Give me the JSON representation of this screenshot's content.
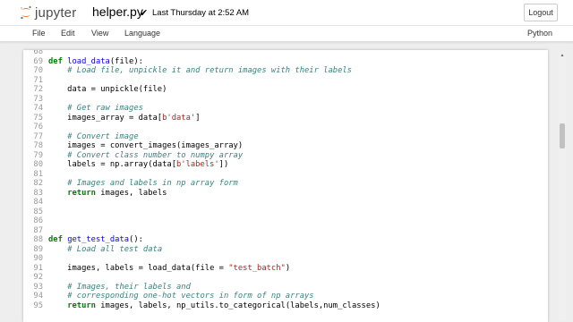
{
  "header": {
    "logo_text": "jupyter",
    "filename": "helper.py",
    "save_check": "✔",
    "save_status": "Last Thursday at 2:52 AM",
    "logout_label": "Logout"
  },
  "menu": {
    "items": [
      "File",
      "Edit",
      "View",
      "Language"
    ],
    "language_indicator": "Python"
  },
  "colors": {
    "keyword": "#008000",
    "function_name": "#0000ff",
    "comment": "#408080",
    "string": "#ba2121",
    "line_number": "#999999",
    "logo_orange": "#f37726"
  },
  "code_lines": [
    {
      "n": "68",
      "tokens": []
    },
    {
      "n": "69",
      "tokens": [
        {
          "t": "kw",
          "v": "def "
        },
        {
          "t": "def",
          "v": "load_data"
        },
        {
          "t": "",
          "v": "(file):"
        }
      ]
    },
    {
      "n": "70",
      "tokens": [
        {
          "t": "",
          "v": "    "
        },
        {
          "t": "cm",
          "v": "# Load file, unpickle it and return images with their labels"
        }
      ]
    },
    {
      "n": "71",
      "tokens": []
    },
    {
      "n": "72",
      "tokens": [
        {
          "t": "",
          "v": "    data = unpickle(file)"
        }
      ]
    },
    {
      "n": "73",
      "tokens": []
    },
    {
      "n": "74",
      "tokens": [
        {
          "t": "",
          "v": "    "
        },
        {
          "t": "cm",
          "v": "# Get raw images"
        }
      ]
    },
    {
      "n": "75",
      "tokens": [
        {
          "t": "",
          "v": "    images_array = data["
        },
        {
          "t": "st",
          "v": "b'data'"
        },
        {
          "t": "",
          "v": "]"
        }
      ]
    },
    {
      "n": "76",
      "tokens": []
    },
    {
      "n": "77",
      "tokens": [
        {
          "t": "",
          "v": "    "
        },
        {
          "t": "cm",
          "v": "# Convert image"
        }
      ]
    },
    {
      "n": "78",
      "tokens": [
        {
          "t": "",
          "v": "    images = convert_images(images_array)"
        }
      ]
    },
    {
      "n": "79",
      "tokens": [
        {
          "t": "",
          "v": "    "
        },
        {
          "t": "cm",
          "v": "# Convert class number to numpy array"
        }
      ]
    },
    {
      "n": "80",
      "tokens": [
        {
          "t": "",
          "v": "    labels = np.array(data["
        },
        {
          "t": "st",
          "v": "b'labels'"
        },
        {
          "t": "",
          "v": "])"
        }
      ]
    },
    {
      "n": "81",
      "tokens": []
    },
    {
      "n": "82",
      "tokens": [
        {
          "t": "",
          "v": "    "
        },
        {
          "t": "cm",
          "v": "# Images and labels in np array form"
        }
      ]
    },
    {
      "n": "83",
      "tokens": [
        {
          "t": "",
          "v": "    "
        },
        {
          "t": "kw",
          "v": "return"
        },
        {
          "t": "",
          "v": " images, labels"
        }
      ]
    },
    {
      "n": "84",
      "tokens": []
    },
    {
      "n": "85",
      "tokens": []
    },
    {
      "n": "86",
      "tokens": []
    },
    {
      "n": "87",
      "tokens": []
    },
    {
      "n": "88",
      "tokens": [
        {
          "t": "kw",
          "v": "def "
        },
        {
          "t": "def",
          "v": "get_test_data"
        },
        {
          "t": "",
          "v": "():"
        }
      ]
    },
    {
      "n": "89",
      "tokens": [
        {
          "t": "",
          "v": "    "
        },
        {
          "t": "cm",
          "v": "# Load all test data"
        }
      ]
    },
    {
      "n": "90",
      "tokens": []
    },
    {
      "n": "91",
      "tokens": [
        {
          "t": "",
          "v": "    images, labels = load_data(file = "
        },
        {
          "t": "st",
          "v": "\"test_batch\""
        },
        {
          "t": "",
          "v": ")"
        }
      ]
    },
    {
      "n": "92",
      "tokens": []
    },
    {
      "n": "93",
      "tokens": [
        {
          "t": "",
          "v": "    "
        },
        {
          "t": "cm",
          "v": "# Images, their labels and"
        }
      ]
    },
    {
      "n": "94",
      "tokens": [
        {
          "t": "",
          "v": "    "
        },
        {
          "t": "cm",
          "v": "# corresponding one-hot vectors in form of np arrays"
        }
      ]
    },
    {
      "n": "95",
      "tokens": [
        {
          "t": "",
          "v": "    "
        },
        {
          "t": "kw",
          "v": "return"
        },
        {
          "t": "",
          "v": " images, labels, np_utils.to_categorical(labels,num_classes)"
        }
      ]
    }
  ]
}
